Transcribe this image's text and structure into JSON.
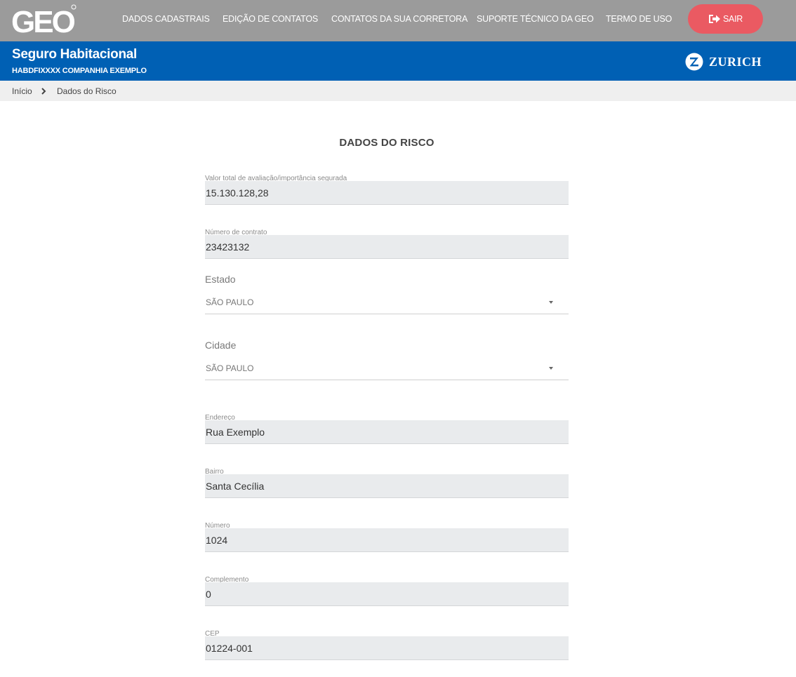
{
  "nav": {
    "logo_text": "GEO",
    "items": [
      {
        "label": "DADOS CADASTRAIS"
      },
      {
        "label": "EDIÇÃO DE CONTATOS"
      },
      {
        "label": "CONTATOS DA SUA CORRETORA"
      },
      {
        "label": "SUPORTE TÉCNICO DA GEO"
      },
      {
        "label": "TERMO DE USO"
      }
    ],
    "logout_label": "SAIR",
    "logout_icon": "logout-icon"
  },
  "header": {
    "title": "Seguro Habitacional",
    "subtitle_code": "HABDFIXXXX",
    "subtitle_company": "COMPANHIA EXEMPLO",
    "brand": "ZURICH"
  },
  "breadcrumb": {
    "home": "Início",
    "current": "Dados do Risco"
  },
  "form": {
    "title": "DADOS DO RISCO",
    "valor": {
      "label": "Valor total de avaliação/importância segurada",
      "value": "15.130.128,28"
    },
    "contrato": {
      "label": "Número de contrato",
      "value": "23423132"
    },
    "estado": {
      "label": "Estado",
      "value": "SÃO PAULO"
    },
    "cidade": {
      "label": "Cidade",
      "value": "SÃO PAULO"
    },
    "endereco": {
      "label": "Endereço",
      "value": "Rua Exemplo"
    },
    "bairro": {
      "label": "Bairro",
      "value": "Santa Cecília"
    },
    "numero": {
      "label": "Número",
      "value": "1024"
    },
    "complemento": {
      "label": "Complemento",
      "value": "0"
    },
    "cep": {
      "label": "CEP",
      "value": "01224-001"
    }
  },
  "colors": {
    "topbar": "#9b9b9b",
    "header": "#0060b4",
    "logout": "#ea5a62",
    "field_bg": "#e9ebed"
  }
}
